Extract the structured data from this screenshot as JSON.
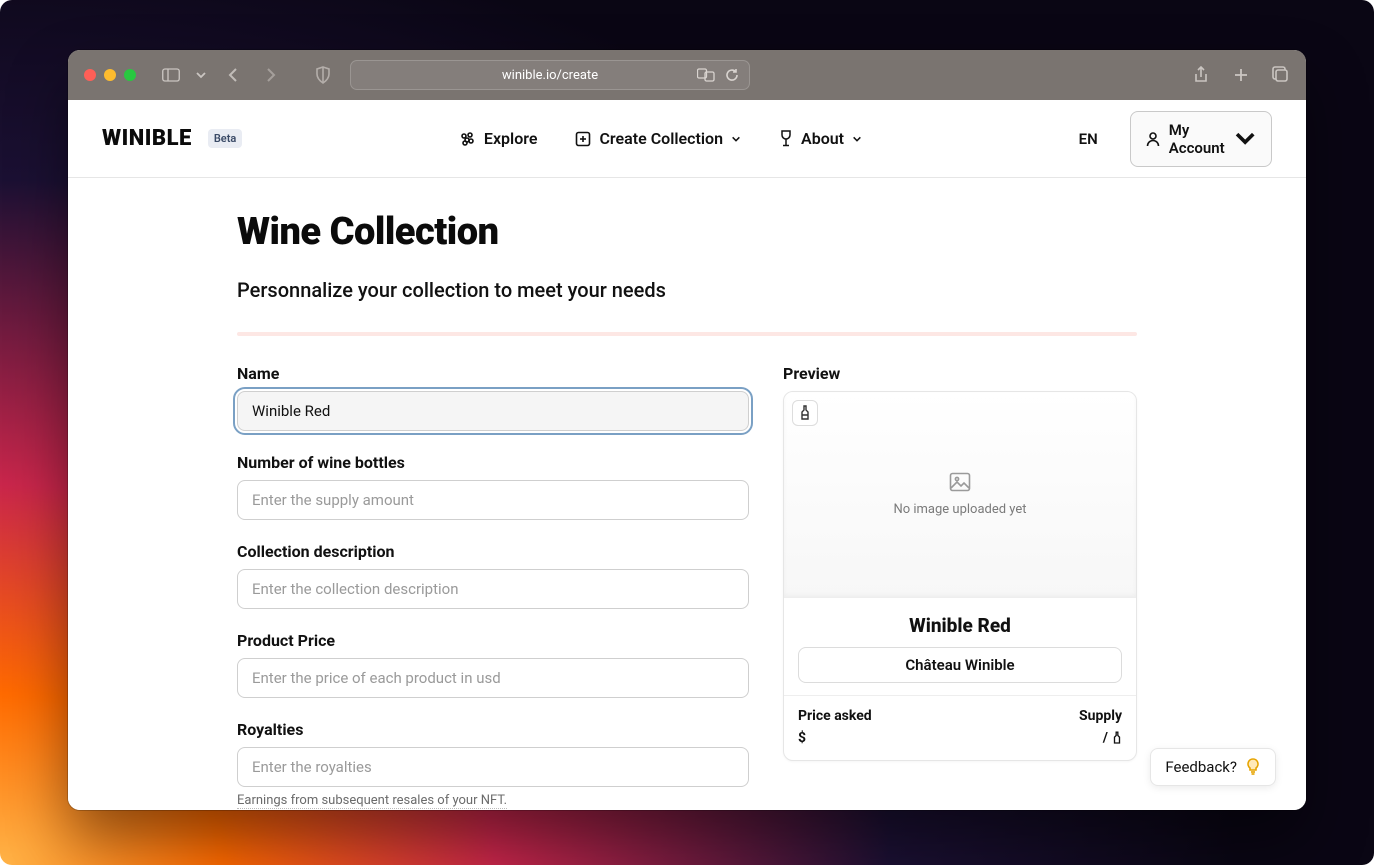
{
  "browser": {
    "url": "winible.io/create"
  },
  "site": {
    "logo": "WINIBLE",
    "beta": "Beta",
    "nav": {
      "explore": "Explore",
      "create": "Create Collection",
      "about": "About"
    },
    "lang": "EN",
    "account": "My Account"
  },
  "page": {
    "title": "Wine Collection",
    "subtitle": "Personnalize your collection to meet your needs"
  },
  "form": {
    "name": {
      "label": "Name",
      "value": "Winible Red"
    },
    "bottles": {
      "label": "Number of wine bottles",
      "placeholder": "Enter the supply amount"
    },
    "description": {
      "label": "Collection description",
      "placeholder": "Enter the collection description"
    },
    "price": {
      "label": "Product Price",
      "placeholder": "Enter the price of each product in usd"
    },
    "royalties": {
      "label": "Royalties",
      "placeholder": "Enter the royalties",
      "hint": "Earnings from subsequent resales of your NFT."
    }
  },
  "preview": {
    "label": "Preview",
    "noimage": "No image uploaded yet",
    "title": "Winible Red",
    "vendor": "Château Winible",
    "price_label": "Price asked",
    "price_value": "$",
    "supply_label": "Supply",
    "supply_sep": "/"
  },
  "feedback": {
    "label": "Feedback?"
  }
}
